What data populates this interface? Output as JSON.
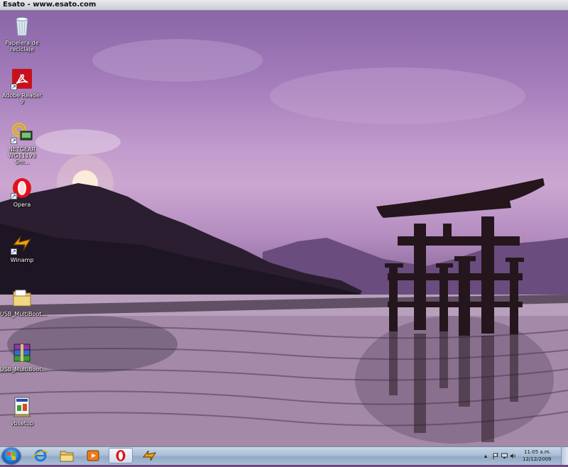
{
  "window": {
    "title": "Esato - www.esato.com"
  },
  "desktop_icons": [
    {
      "label": "Papelera de reciclaje",
      "icon": "recycle-bin-icon"
    },
    {
      "label": "Adobe Reader 9",
      "icon": "adobe-reader-icon"
    },
    {
      "label": "NETGEAR WG111v3 Sm...",
      "icon": "netgear-icon"
    },
    {
      "label": "Opera",
      "icon": "opera-icon"
    },
    {
      "label": "Winamp",
      "icon": "winamp-icon"
    },
    {
      "label": "USB_MultiBoot...",
      "icon": "folder-icon"
    },
    {
      "label": "USB_MultiBoot...",
      "icon": "winrar-archive-icon"
    },
    {
      "label": "vbsetup",
      "icon": "setup-icon"
    }
  ],
  "taskbar": {
    "pinned": [
      "internet-explorer-icon",
      "windows-explorer-icon",
      "media-player-icon",
      "opera-icon",
      "winamp-icon"
    ],
    "clock": {
      "time": "11:05 a.m.",
      "date": "12/12/2009"
    }
  },
  "colors": {
    "taskbar": "#a9bed6",
    "sky": "#c29ccd"
  }
}
